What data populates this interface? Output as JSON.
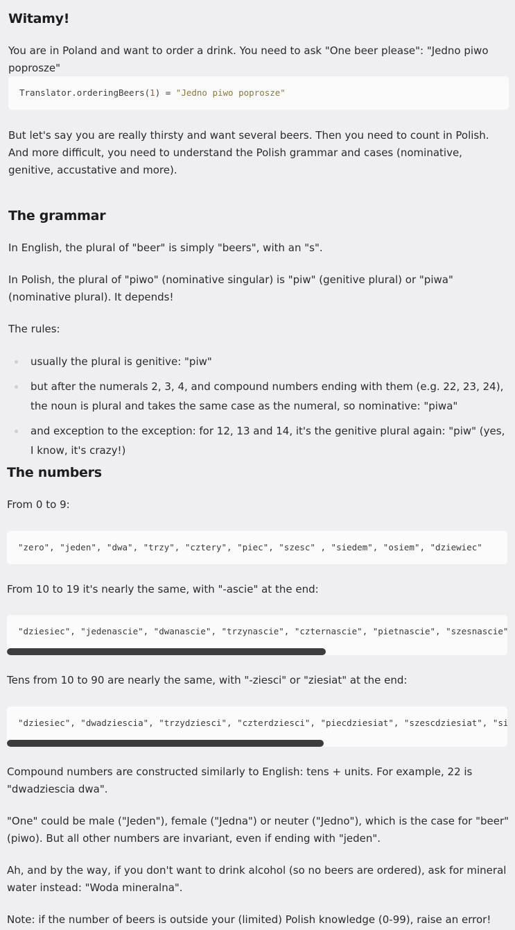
{
  "intro": {
    "title": "Witamy!",
    "p1": "You are in Poland and want to order a drink. You need to ask \"One beer please\": \"Jedno piwo poprosze\"",
    "code": {
      "call": "Translator.orderingBeers(",
      "arg": "1",
      "rest": ") = ",
      "result": "\"Jedno piwo poprosze\""
    },
    "p2": "But let's say you are really thirsty and want several beers. Then you need to count in Polish. And more difficult, you need to understand the Polish grammar and cases (nominative, genitive, accustative and more)."
  },
  "grammar": {
    "title": "The grammar",
    "p1": "In English, the plural of \"beer\" is simply \"beers\", with an \"s\".",
    "p2": "In Polish, the plural of \"piwo\" (nominative singular) is \"piw\" (genitive plural) or \"piwa\" (nominative plural). It depends!",
    "rules_label": "The rules:",
    "rules": [
      "usually the plural is genitive: \"piw\"",
      "but after the numerals 2, 3, 4, and compound numbers ending with them (e.g. 22, 23, 24), the noun is plural and takes the same case as the numeral, so nominative: \"piwa\"",
      "and exception to the exception: for 12, 13 and 14, it's the genitive plural again: \"piw\" (yes, I know, it's crazy!)"
    ]
  },
  "numbers": {
    "title": "The numbers",
    "p_units": "From 0 to 9:",
    "code_units": "\"zero\", \"jeden\", \"dwa\", \"trzy\", \"cztery\", \"piec\", \"szesc\" , \"siedem\", \"osiem\", \"dziewiec\"",
    "p_teens": "From 10 to 19 it's nearly the same, with \"-ascie\" at the end:",
    "code_teens": "\"dziesiec\", \"jedenascie\", \"dwanascie\", \"trzynascie\", \"czternascie\", \"pietnascie\", \"szesnascie\", \"siedemnascie\", \"osiemnascie\", \"dziewietnascie\"",
    "p_tens": "Tens from 10 to 90 are nearly the same, with \"-ziesci\" or \"ziesiat\" at the end:",
    "code_tens": "\"dziesiec\", \"dwadziescia\", \"trzydziesci\", \"czterdziesci\", \"piecdziesiat\", \"szescdziesiat\", \"siedemdziesiat\", \"osiemdziesiat\", \"dziewiecdziesiat\"",
    "p_compound": "Compound numbers are constructed similarly to English: tens + units. For example, 22 is \"dwadziescia dwa\".",
    "p_one": "\"One\" could be male (\"Jeden\"), female (\"Jedna\") or neuter (\"Jedno\"), which is the case for \"beer\" (piwo). But all other numbers are invariant, even if ending with \"jeden\".",
    "p_water": "Ah, and by the way, if you don't want to drink alcohol (so no beers are ordered), ask for mineral water instead: \"Woda mineralna\".",
    "p_note": "Note: if the number of beers is outside your (limited) Polish knowledge (0-99), raise an error!"
  }
}
